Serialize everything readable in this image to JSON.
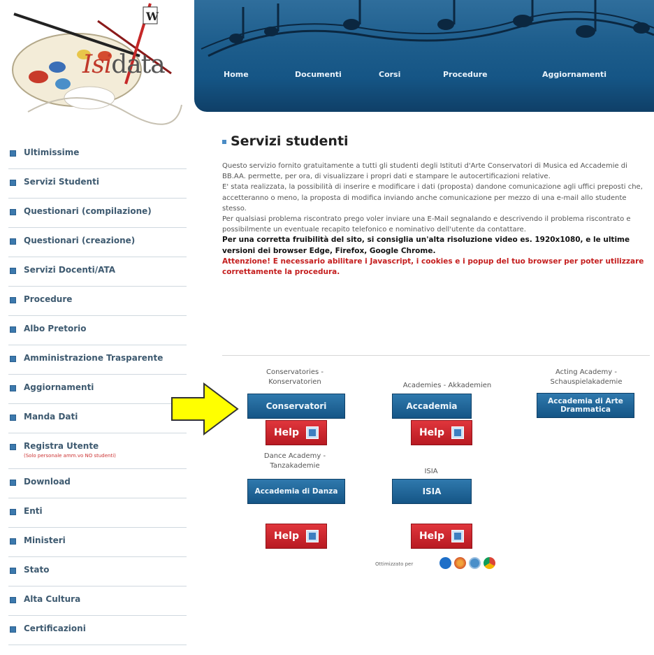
{
  "logo": {
    "text_colored": "Isi",
    "text_rest": "data"
  },
  "nav": [
    "Home",
    "Documenti",
    "Corsi",
    "Procedure",
    "Aggiornamenti"
  ],
  "sidebar": {
    "items": [
      "Ultimissime",
      "Servizi Studenti",
      "Questionari (compilazione)",
      "Questionari (creazione)",
      "Servizi Docenti/ATA",
      "Procedure",
      "Albo Pretorio",
      "Amministrazione Trasparente",
      "Aggiornamenti",
      "Manda Dati",
      "Registra Utente",
      "Download",
      "Enti",
      "Ministeri",
      "Stato",
      "Alta Cultura",
      "Certificazioni"
    ],
    "note": "(Solo personale amm.vo NO studenti)"
  },
  "main": {
    "title": "Servizi studenti",
    "paragraphs": [
      "Questo servizio fornito gratuitamente a tutti gli studenti degli Istituti d'Arte Conservatori di Musica ed Accademie di BB.AA. permette, per ora, di visualizzare i propri dati e stampare le autocertificazioni relative.",
      "E' stata realizzata, la possibilità di inserire e modificare i dati (proposta) dandone comunicazione agli uffici preposti che, accetteranno o meno, la proposta di modifica inviando anche comunicazione per mezzo di una e-mail allo studente stesso.",
      "Per qualsiasi problema riscontrato prego voler inviare una E-Mail segnalando e descrivendo il problema riscontrato e possibilmente un eventuale recapito telefonico e nominativo dell'utente da contattare."
    ],
    "resolution_note": "Per una corretta fruibilità del sito, si consiglia un'alta risoluzione video es. 1920x1080, e le ultime versioni dei browser Edge, Firefox, Google Chrome.",
    "warning": "Attenzione! E necessario abilitare i Javascript, i cookies e i popup del tuo browser per poter utilizzare correttamente la procedura."
  },
  "services": {
    "conservatori": {
      "caption": "Conservatories - Konservatorien",
      "label": "Conservatori"
    },
    "accademia": {
      "caption": "Academies - Akkademien",
      "label": "Accademia"
    },
    "arte_drammatica": {
      "caption": "Acting Academy - Schauspielakademie",
      "label": "Accademia di Arte Drammatica"
    },
    "danza": {
      "caption": "Dance Academy - Tanzakademie",
      "label": "Accademia di Danza"
    },
    "isia": {
      "caption": "ISIA",
      "label": "ISIA"
    },
    "help_label": "Help"
  },
  "footer": {
    "optimized": "Ottimizzato per"
  },
  "colors": {
    "header": "#1d5d8c",
    "help": "#c8232a",
    "accent": "#2f79ad"
  }
}
